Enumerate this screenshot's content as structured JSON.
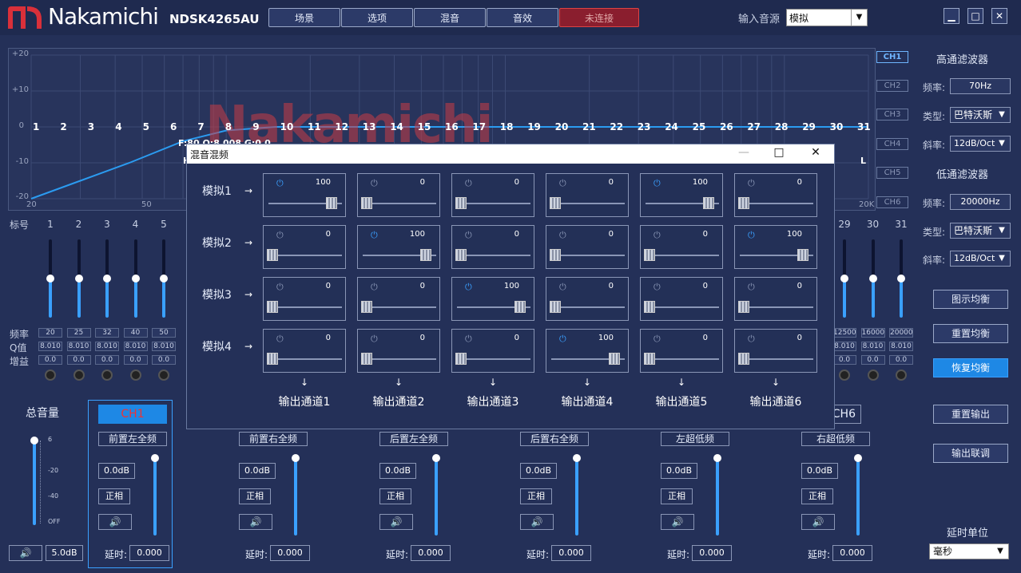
{
  "header": {
    "brand": "Nakamichi",
    "model": "NDSK4265AU",
    "buttons": [
      "场景",
      "选项",
      "混音",
      "音效"
    ],
    "status_button": "未连接",
    "input_source_label": "输入音源",
    "input_source_value": "模拟",
    "window_controls": [
      "▁",
      "□",
      "✕"
    ]
  },
  "chart": {
    "y_ticks": [
      "+20",
      "+10",
      "0",
      "-10",
      "-20"
    ],
    "x_ticks": [
      "20",
      "50",
      "20K"
    ],
    "bands": [
      "1",
      "2",
      "3",
      "4",
      "5",
      "6",
      "7",
      "8",
      "9",
      "10",
      "11",
      "12",
      "13",
      "14",
      "15",
      "16",
      "17",
      "18",
      "19",
      "20",
      "21",
      "22",
      "23",
      "24",
      "25",
      "26",
      "27",
      "28",
      "29",
      "30",
      "31"
    ],
    "info_text": "F:80 Q:8.008 G:0.0",
    "marker_h": "H",
    "marker_l": "L",
    "watermark": "Nakamichi"
  },
  "chart_data": {
    "type": "line",
    "title": "",
    "xlabel": "",
    "ylabel": "",
    "x_scale": "log",
    "xlim": [
      20,
      20000
    ],
    "ylim": [
      -20,
      20
    ],
    "series": [
      {
        "x": [
          20,
          30,
          45,
          70,
          100,
          150,
          300,
          1000,
          5000,
          20000
        ],
        "y": [
          -20,
          -15,
          -10,
          -4,
          -1,
          0,
          0,
          0,
          0,
          0
        ]
      }
    ]
  },
  "channels": [
    "CH1",
    "CH2",
    "CH3",
    "CH4",
    "CH5",
    "CH6"
  ],
  "high_pass": {
    "title": "高通滤波器",
    "freq_label": "频率:",
    "freq": "70Hz",
    "type_label": "类型:",
    "type": "巴特沃斯",
    "slope_label": "斜率:",
    "slope": "12dB/Oct"
  },
  "low_pass": {
    "title": "低通滤波器",
    "freq_label": "频率:",
    "freq": "20000Hz",
    "type_label": "类型:",
    "type": "巴特沃斯",
    "slope_label": "斜率:",
    "slope": "12dB/Oct"
  },
  "eq_buttons": {
    "graphic": "图示均衡",
    "reset": "重置均衡",
    "restore": "恢复均衡",
    "reset_output": "重置输出",
    "output_link": "输出联调"
  },
  "eq": {
    "label_band": "标号",
    "label_freq": "频率",
    "label_q": "Q值",
    "label_gain": "增益",
    "left_bands": [
      {
        "n": "1",
        "f": "20",
        "q": "8.010",
        "g": "0.0"
      },
      {
        "n": "2",
        "f": "25",
        "q": "8.010",
        "g": "0.0"
      },
      {
        "n": "3",
        "f": "32",
        "q": "8.010",
        "g": "0.0"
      },
      {
        "n": "4",
        "f": "40",
        "q": "8.010",
        "g": "0.0"
      },
      {
        "n": "5",
        "f": "50",
        "q": "8.010",
        "g": "0.0"
      }
    ],
    "right_bands": [
      {
        "n": "29",
        "f": "12500",
        "q": "8.010",
        "g": "0.0"
      },
      {
        "n": "30",
        "f": "16000",
        "q": "8.010",
        "g": "0.0"
      },
      {
        "n": "31",
        "f": "20000",
        "q": "8.010",
        "g": "0.0"
      }
    ]
  },
  "master": {
    "title": "总音量",
    "scale": [
      "6",
      "-20",
      "-40",
      "OFF"
    ],
    "value": "5.0dB",
    "mute_icon": "🔊",
    "level": 0.95
  },
  "outputs": [
    {
      "ch": "CH1",
      "name": "前置左全频",
      "db": "0.0dB",
      "phase": "正相",
      "delay_label": "延时:",
      "delay": "0.000"
    },
    {
      "ch": "",
      "name": "前置右全频",
      "db": "0.0dB",
      "phase": "正相",
      "delay_label": "延时:",
      "delay": "0.000"
    },
    {
      "ch": "",
      "name": "后置左全频",
      "db": "0.0dB",
      "phase": "正相",
      "delay_label": "延时:",
      "delay": "0.000"
    },
    {
      "ch": "",
      "name": "后置右全频",
      "db": "0.0dB",
      "phase": "正相",
      "delay_label": "延时:",
      "delay": "0.000"
    },
    {
      "ch": "",
      "name": "左超低频",
      "db": "0.0dB",
      "phase": "正相",
      "delay_label": "延时:",
      "delay": "0.000"
    },
    {
      "ch": "CH6",
      "name": "右超低频",
      "db": "0.0dB",
      "phase": "正相",
      "delay_label": "延时:",
      "delay": "0.000"
    }
  ],
  "delay_unit": {
    "title": "延时单位",
    "value": "毫秒"
  },
  "mixer": {
    "title": "混音混频",
    "controls": [
      "—",
      "□",
      "✕"
    ],
    "rows": [
      "模拟1",
      "模拟2",
      "模拟3",
      "模拟4"
    ],
    "outputs": [
      "输出通道1",
      "输出通道2",
      "输出通道3",
      "输出通道4",
      "输出通道5",
      "输出通道6"
    ],
    "values": [
      [
        "100",
        "0",
        "0",
        "0",
        "100",
        "0"
      ],
      [
        "0",
        "100",
        "0",
        "0",
        "0",
        "100"
      ],
      [
        "0",
        "0",
        "100",
        "0",
        "0",
        "0"
      ],
      [
        "0",
        "0",
        "0",
        "100",
        "0",
        "0"
      ]
    ],
    "accent": "#3aa0ff",
    "inactive": "#8a96b6"
  }
}
